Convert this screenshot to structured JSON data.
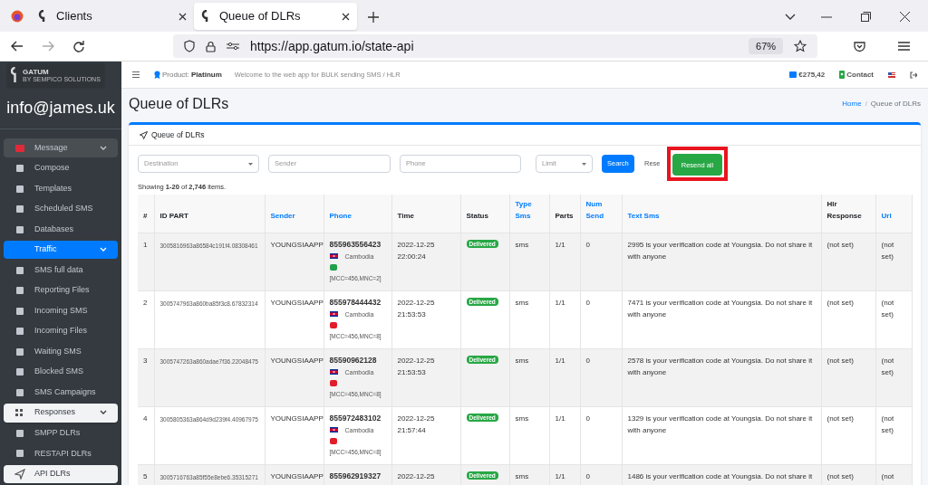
{
  "browser": {
    "tabs": [
      {
        "label": "Clients",
        "selected": false
      },
      {
        "label": "Queue of DLRs",
        "selected": true
      }
    ],
    "url": "https://app.gatum.io/state-api",
    "zoom": "67%"
  },
  "sidebar": {
    "brand": "GATUM",
    "brand_sub": "BY SEMPICO SOLUTIONS",
    "user": "info@james.uk",
    "items": [
      {
        "label": "Message",
        "kind": "group",
        "expanded": true,
        "selected": false,
        "active": false
      },
      {
        "label": "Compose",
        "kind": "item",
        "selected": false,
        "active": false
      },
      {
        "label": "Templates",
        "kind": "item",
        "selected": false,
        "active": false
      },
      {
        "label": "Scheduled SMS",
        "kind": "item",
        "selected": false,
        "active": false
      },
      {
        "label": "Databases",
        "kind": "item",
        "selected": false,
        "active": false
      },
      {
        "label": "Traffic",
        "kind": "group",
        "expanded": true,
        "selected": true,
        "active": false
      },
      {
        "label": "SMS full data",
        "kind": "item",
        "selected": false,
        "active": false
      },
      {
        "label": "Reporting Files",
        "kind": "item",
        "selected": false,
        "active": false
      },
      {
        "label": "Incoming SMS",
        "kind": "item",
        "selected": false,
        "active": false
      },
      {
        "label": "Incoming Files",
        "kind": "item",
        "selected": false,
        "active": false
      },
      {
        "label": "Waiting SMS",
        "kind": "item",
        "selected": false,
        "active": false
      },
      {
        "label": "Blocked SMS",
        "kind": "item",
        "selected": false,
        "active": false
      },
      {
        "label": "SMS Campaigns",
        "kind": "item",
        "selected": false,
        "active": false
      },
      {
        "label": "Responses",
        "kind": "group",
        "expanded": true,
        "selected": false,
        "active": true
      },
      {
        "label": "SMPP DLRs",
        "kind": "item",
        "selected": false,
        "active": false
      },
      {
        "label": "RESTAPI DLRs",
        "kind": "item",
        "selected": false,
        "active": false
      },
      {
        "label": "API DLRs",
        "kind": "item",
        "selected": false,
        "active": true
      }
    ]
  },
  "topbar": {
    "product_label": "Product:",
    "product": "Platinum",
    "welcome": "Welcome to the web app for BULK sending SMS / HLR",
    "balance": "€275,42",
    "contact": "Contact"
  },
  "page": {
    "title": "Queue of DLRs",
    "breadcrumb": [
      "Home",
      "Queue of DLRs"
    ],
    "breadcrumb_separator": "/"
  },
  "card": {
    "title": "Queue of DLRs",
    "filters": {
      "destination": "Destination",
      "sender": "Sender",
      "phone": "Phone",
      "limit": "Limit",
      "search": "Search",
      "reset": "Rese",
      "resend": "Resend all",
      "resend_highlighted": true
    },
    "summary": "Showing **1-20** of **2,746** items.",
    "columns": [
      {
        "label": "#",
        "link": false
      },
      {
        "label": "ID PART",
        "link": false
      },
      {
        "label": "Sender",
        "link": true
      },
      {
        "label": "Phone",
        "link": true
      },
      {
        "label": "Time",
        "link": false
      },
      {
        "label": "Status",
        "link": false
      },
      {
        "label": "Type Sms",
        "link": true
      },
      {
        "label": "Parts",
        "link": false
      },
      {
        "label": "Num Send",
        "link": true
      },
      {
        "label": "Text Sms",
        "link": true
      },
      {
        "label": "Hlr Response",
        "link": false
      },
      {
        "label": "Url",
        "link": true
      }
    ],
    "rows": [
      {
        "num": "1",
        "id": "3005816963a86584c191f4.08308461",
        "sender": "YOUNGSIAAPP",
        "phone": "855963556423",
        "country": "Cambodia",
        "color": "#22a04a",
        "network": "[MCC=456,MNC=2]",
        "date": "2022-12-25",
        "time": "22:00:24",
        "status": "Delivered",
        "type": "sms",
        "parts": "1/1",
        "num_send": "0",
        "text": "2995 is your verification code at Youngsia. Do not share it with anyone",
        "hlr": "(not set)",
        "url": "(not set)"
      },
      {
        "num": "2",
        "id": "3005747963a860ba85f3c8.67832314",
        "sender": "YOUNGSIAAPP",
        "phone": "855978444432",
        "country": "Cambodia",
        "color": "#e11d2a",
        "network": "[MCC=456,MNC=8]",
        "date": "2022-12-25",
        "time": "21:53:53",
        "status": "Delivered",
        "type": "sms",
        "parts": "1/1",
        "num_send": "0",
        "text": "7471 is your verification code at Youngsia. Do not share it with anyone",
        "hlr": "(not set)",
        "url": "(not set)"
      },
      {
        "num": "3",
        "id": "3005747263a860adae7f36.22048475",
        "sender": "YOUNGSIAAPP",
        "phone": "85590962128",
        "country": "Cambodia",
        "color": "#e11d2a",
        "network": "[MCC=456,MNC=8]",
        "date": "2022-12-25",
        "time": "21:53:53",
        "status": "Delivered",
        "type": "sms",
        "parts": "1/1",
        "num_send": "0",
        "text": "2578 is your verification code at Youngsia. Do not share it with anyone",
        "hlr": "(not set)",
        "url": "(not set)"
      },
      {
        "num": "4",
        "id": "3005805363a864d9d239f4.40967975",
        "sender": "YOUNGSIAAPP",
        "phone": "855972483102",
        "country": "Cambodia",
        "color": "#e11d2a",
        "network": "[MCC=456,MNC=8]",
        "date": "2022-12-25",
        "time": "21:57:44",
        "status": "Delivered",
        "type": "sms",
        "parts": "1/1",
        "num_send": "0",
        "text": "1329 is your verification code at Youngsia. Do not share it with anyone",
        "hlr": "(not set)",
        "url": "(not set)"
      },
      {
        "num": "5",
        "id": "3005716763a85f55e8ebe6.35315271",
        "sender": "YOUNGSIAAPP",
        "phone": "855962919327",
        "date": "2022-12-25",
        "status": "Delivered",
        "type": "sms",
        "parts": "1/1",
        "num_send": "0",
        "text": "1486 is your verification code at Youngsia. Do not share it",
        "hlr": "(not set)",
        "url": "(not"
      }
    ]
  }
}
